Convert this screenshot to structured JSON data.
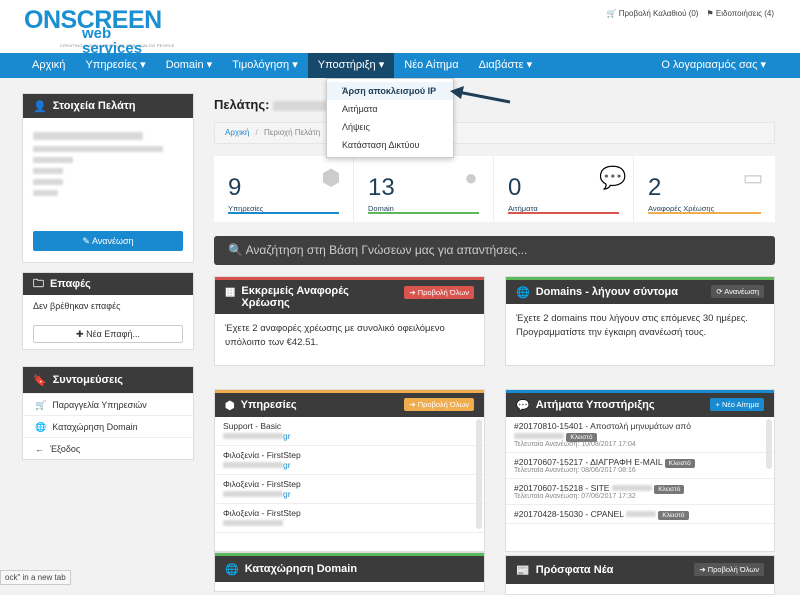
{
  "brand": {
    "logo_main": "ONSCREEN",
    "logo_sub": "web services",
    "tagline": "CREATING DIGITAL PROFILES FOR ANALOG PEOPLE"
  },
  "toplinks": {
    "cart": "Προβολή Καλαθιού (0)",
    "notifications": "Ειδοποιήσεις (4)"
  },
  "nav": {
    "items": [
      "Αρχική",
      "Υπηρεσίες",
      "Domain",
      "Τιμολόγηση",
      "Υποστήριξη",
      "Νέο Αίτημα",
      "Διαβάστε"
    ],
    "account": "Ο λογαριασμός σας"
  },
  "dropdown": {
    "items": [
      "Άρση αποκλεισμού IP",
      "Αιτήματα",
      "Λήψεις",
      "Κατάσταση Δικτύου"
    ]
  },
  "client": {
    "title": "Στοιχεία Πελάτη",
    "refresh": "Ανανέωση"
  },
  "contacts": {
    "title": "Επαφές",
    "empty": "Δεν βρέθηκαν επαφές",
    "new": "Νέα Επαφή..."
  },
  "shortcuts": {
    "title": "Συντομεύσεις",
    "items": [
      "Παραγγελία Υπηρεσιών",
      "Καταχώρηση Domain",
      "Έξοδος"
    ]
  },
  "page": {
    "title": "Πελάτης:",
    "breadcrumb_home": "Αρχική",
    "breadcrumb_current": "Περιοχή Πελάτη"
  },
  "stats": [
    {
      "num": "9",
      "label": "Υπηρεσίες",
      "color": "#1a8ad0"
    },
    {
      "num": "13",
      "label": "Domain",
      "color": "#5cb85c"
    },
    {
      "num": "0",
      "label": "Αιτήματα",
      "color": "#d9534f"
    },
    {
      "num": "2",
      "label": "Αναφορές Χρέωσης",
      "color": "#f0ad4e"
    }
  ],
  "search": {
    "placeholder": "Αναζήτηση στη Βάση Γνώσεων μας για απαντήσεις..."
  },
  "invoices": {
    "title": "Εκκρεμείς Αναφορές Χρέωσης",
    "btn": "Προβολή Όλων",
    "text": "Έχετε 2 αναφορές χρέωσης με συνολικό οφειλόμενο υπόλοιπο των €42.51."
  },
  "domains": {
    "title": "Domains - λήγουν σύντομα",
    "btn": "Ανανέωση",
    "text": "Έχετε 2 domains που λήγουν στις επόμενες 30 ημέρες. Προγραμματίστε την έγκαιρη ανανέωσή τους."
  },
  "services": {
    "title": "Υπηρεσίες",
    "btn": "Προβολή Όλων",
    "items": [
      {
        "name": "Support - Basic",
        "suffix": "gr"
      },
      {
        "name": "Φιλοξενία - FirstStep",
        "suffix": "gr"
      },
      {
        "name": "Φιλοξενία - FirstStep",
        "suffix": "gr"
      },
      {
        "name": "Φιλοξενία - FirstStep",
        "suffix": ""
      }
    ]
  },
  "tickets": {
    "title": "Αιτήματα Υποστήριξης",
    "btn": "Νέο Αίτημα",
    "items": [
      {
        "id": "#20170810-15401 - Αποστολή μηνυμάτων από",
        "tag": "Κλειστό",
        "updated": "Τελευταία Ανανέωση: 10/08/2017 17:04"
      },
      {
        "id": "#20170607-15217 - ΔΙΑΓΡΑΦΗ E-MAIL",
        "tag": "Κλειστό",
        "updated": "Τελευταία Ανανέωση: 08/06/2017 08:16"
      },
      {
        "id": "#20170607-15218 - SITE",
        "tag": "Κλειστό",
        "updated": "Τελευταία Ανανέωση: 07/06/2017 17:32"
      },
      {
        "id": "#20170428-15030 - CPANEL",
        "tag": "Κλειστό",
        "updated": ""
      }
    ]
  },
  "register": {
    "title": "Καταχώρηση Domain"
  },
  "news": {
    "title": "Πρόσφατα Νέα",
    "btn": "Προβολή Όλων"
  },
  "statusbar": {
    "text": "ock\" in a new tab"
  }
}
